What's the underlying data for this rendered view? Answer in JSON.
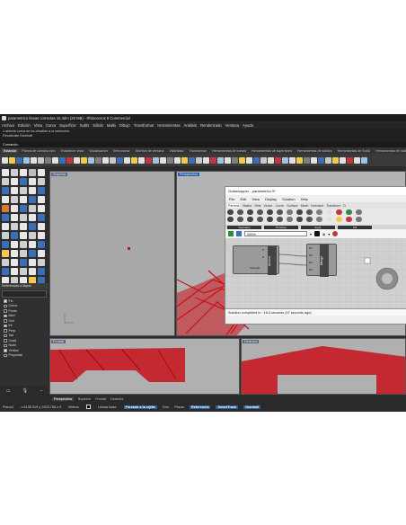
{
  "window": {
    "title": "parametrico lineas correctas 15.3dm (20 MB) - Rhinoceros 8 Commercial"
  },
  "menubar": {
    "items": [
      "Archivo",
      "Edición",
      "Vista",
      "Curva",
      "Superficie",
      "SubD",
      "Sólido",
      "Malla",
      "Dibujo",
      "Transformar",
      "Herramientas",
      "Análisis",
      "Renderizado",
      "Ventana",
      "Ayuda"
    ]
  },
  "command_history": {
    "lines": [
      "1 abierta curva se ha añadido a la selección.",
      "Recalcular Gumball"
    ]
  },
  "command_prompt": "Comando:",
  "toolbar_tabs": {
    "items": [
      "Estándar",
      "Planos de construcción",
      "Establecer vista",
      "Visualización",
      "Seleccionar",
      "Diseños de ventana",
      "Visibilidad",
      "Transformar",
      "Herramientas de curvas",
      "Herramientas de superficies",
      "Herramientas de sólidos",
      "Herramientas de SubD",
      "Herramientas de mallas",
      "Renderizado",
      "Dibujo",
      "Novedades en V8"
    ]
  },
  "colors": {
    "accent": "#2a5fa8",
    "model_red": "#c8101a",
    "viewport_bg": "#b4b4b4",
    "ui_dark": "#2b2b2b"
  },
  "viewports": {
    "top": {
      "label": "Superior"
    },
    "perspective": {
      "label": "Perspectiva"
    },
    "front": {
      "label": "Frontal"
    },
    "right": {
      "label": "Derecha"
    }
  },
  "layers_panel": {
    "header": "Referencias a objeto",
    "items": [
      {
        "label": "Fin",
        "checked": true
      },
      {
        "label": "Cerca",
        "checked": false
      },
      {
        "label": "Punto",
        "checked": false
      },
      {
        "label": "Med",
        "checked": true
      },
      {
        "label": "Cen",
        "checked": false
      },
      {
        "label": "Int",
        "checked": true
      },
      {
        "label": "Perp",
        "checked": false
      },
      {
        "label": "Tan",
        "checked": false
      },
      {
        "label": "Cuad",
        "checked": false
      },
      {
        "label": "Nudo",
        "checked": false
      },
      {
        "label": "Vértice",
        "checked": true
      },
      {
        "label": "Proyectar",
        "checked": false
      }
    ]
  },
  "grasshopper": {
    "title": "Grasshopper - parametrico 9*",
    "menu": [
      "File",
      "Edit",
      "View",
      "Display",
      "Solution",
      "Help"
    ],
    "tabs": [
      "Params",
      "Maths",
      "Sets",
      "Vector",
      "Curve",
      "Surface",
      "Mesh",
      "Intersect",
      "Transform",
      "D"
    ],
    "categories": [
      "Geometry",
      "Primitive",
      "Input",
      "Util"
    ],
    "zoom": "200%",
    "components": {
      "anchor": {
        "name": "Anchor",
        "ports": [
          "P",
          "D",
          "Strength"
        ]
      },
      "merge": {
        "name": "Merge",
        "ports": [
          "D1",
          "D2",
          "D3",
          "D4"
        ]
      }
    },
    "status": "Solution completed in ~16.0 seconds (47 seconds ago)"
  },
  "viewport_tabs": {
    "items": [
      "Perspectiva",
      "Superior",
      "Frontal",
      "Derecha"
    ]
  },
  "statusbar": {
    "cplane": "PlanoC",
    "coords": "x 6135.319   y 2923.798   z 0",
    "units": "Metros",
    "layer": "Líneas base",
    "toggles": [
      "Forzado a la rejilla",
      "Orto",
      "Planar",
      "Referencia",
      "SmartTrack",
      "Gumball"
    ]
  }
}
